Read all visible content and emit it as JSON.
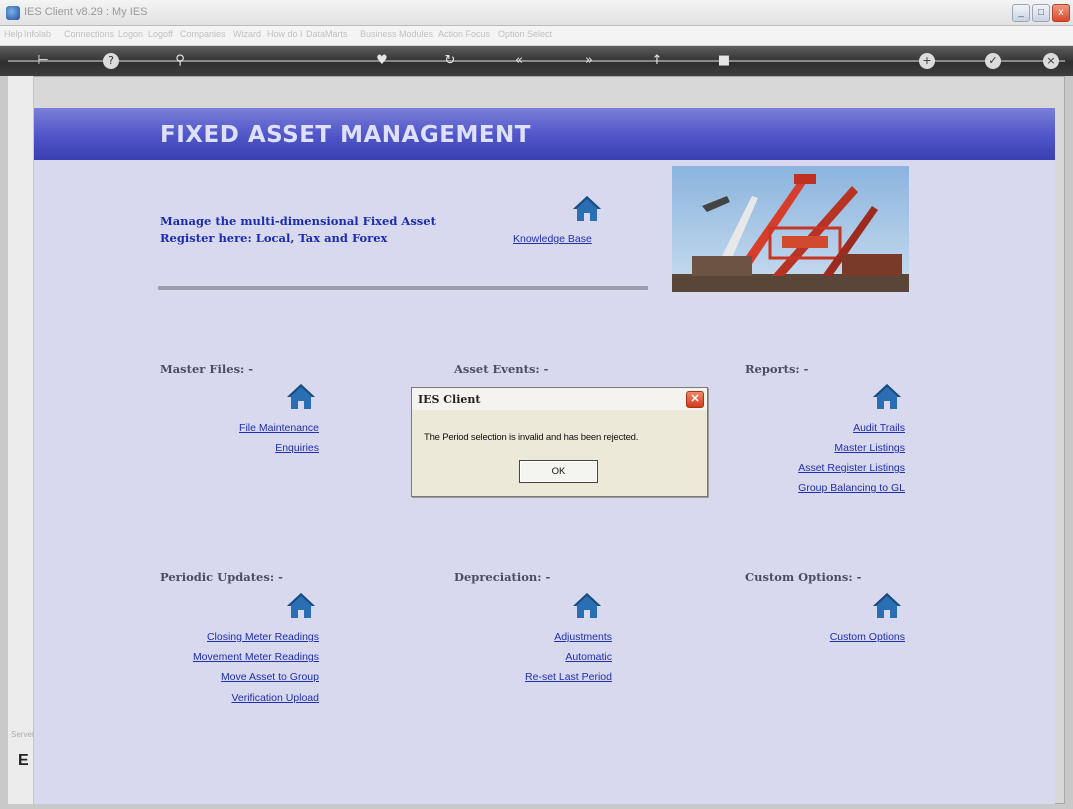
{
  "window": {
    "title": "IES Client v8.29 : My IES"
  },
  "menu": [
    "Help",
    "Infolab",
    "Connections",
    "Logon",
    "Logoff",
    "Companies",
    "Wizard",
    "How do I",
    "DataMarts",
    "Business Modules",
    "Action Focus",
    "Option Select"
  ],
  "toolbar": {
    "icons": [
      "bar-arrow-icon",
      "help-icon",
      "search-icon",
      "heart-icon",
      "refresh-icon",
      "back-icon",
      "forward-icon",
      "up-icon",
      "stop-icon",
      "plus-icon",
      "check-icon",
      "close-icon"
    ]
  },
  "page": {
    "title": "FIXED ASSET MANAGEMENT",
    "intro": "Manage the multi-dimensional Fixed Asset Register here: Local, Tax and Forex",
    "knowledge_base": "Knowledge Base"
  },
  "sections": {
    "master_files": {
      "title": "Master Files: -",
      "links": [
        "File Maintenance",
        "Enquiries"
      ]
    },
    "asset_events": {
      "title": "Asset Events: -"
    },
    "reports": {
      "title": "Reports: -",
      "links": [
        "Audit Trails",
        "Master Listings",
        "Asset Register Listings",
        "Group Balancing to GL"
      ]
    },
    "periodic_updates": {
      "title": "Periodic Updates: -",
      "links": [
        "Closing Meter Readings",
        "Movement Meter Readings",
        "Move Asset to Group",
        "Verification Upload"
      ]
    },
    "depreciation": {
      "title": "Depreciation: -",
      "links": [
        "Adjustments",
        "Automatic",
        "Re-set Last Period"
      ]
    },
    "custom_options": {
      "title": "Custom Options: -",
      "links": [
        "Custom Options"
      ]
    }
  },
  "dialog": {
    "title": "IES Client",
    "message": "The Period selection is invalid and has been rejected.",
    "ok": "OK"
  },
  "gutter": {
    "label": "Servers",
    "letter": "E"
  },
  "colors": {
    "banner": "#4f54c7",
    "link": "#1f2fb0",
    "content_bg": "#d8d8ee",
    "icon_blue": "#2a6fb3"
  }
}
